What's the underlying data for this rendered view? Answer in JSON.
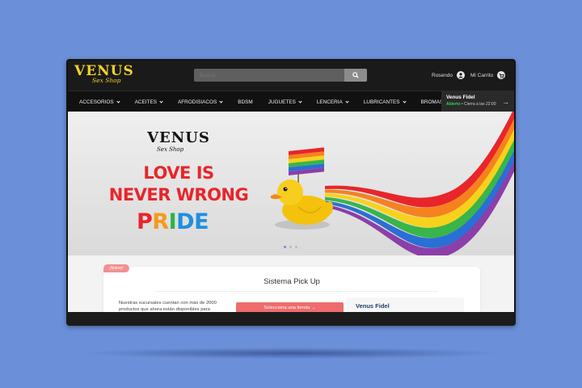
{
  "header": {
    "logo": "VENUS",
    "logo_sub": "Sex Shop",
    "search_placeholder": "Buscar",
    "user_name": "Rosendo",
    "cart_label": "Mi Carrito"
  },
  "nav": {
    "items": [
      {
        "label": "ACCESORIOS",
        "dropdown": true
      },
      {
        "label": "ACEITES",
        "dropdown": true
      },
      {
        "label": "AFRODISIACOS",
        "dropdown": true
      },
      {
        "label": "BDSM",
        "dropdown": false
      },
      {
        "label": "JUGUETES",
        "dropdown": true
      },
      {
        "label": "LENCERIA",
        "dropdown": true
      },
      {
        "label": "LUBRICANTES",
        "dropdown": true
      },
      {
        "label": "BROMAS",
        "dropdown": false
      }
    ],
    "store": {
      "name": "Venus Fidel",
      "open": "Abierto",
      "closes": "• Cierra a las 22:00"
    }
  },
  "banner": {
    "logo": "VENUS",
    "logo_sub": "Sex Shop",
    "line1": "LOVE IS",
    "line2": "NEVER WRONG",
    "pride_letters": [
      {
        "ch": "P",
        "color": "#e8252a"
      },
      {
        "ch": "R",
        "color": "#f59a1b"
      },
      {
        "ch": "I",
        "color": "#2db34a"
      },
      {
        "ch": "D",
        "color": "#1f8fe0"
      },
      {
        "ch": "E",
        "color": "#1f8fe0"
      }
    ],
    "slides": 3,
    "active_slide": 1,
    "rainbow_colors": [
      "#e8252a",
      "#f5821f",
      "#f7d21c",
      "#39b54a",
      "#2a6fd6",
      "#8b3fa8"
    ]
  },
  "pickup": {
    "tag": "¡Nuevo!",
    "title": "Sistema Pick Up",
    "text": "Nuestras sucursales cuentan con más de 2000 productos que ahora están disponibles para",
    "button_label": "Selecciona una tienda",
    "store_name": "Venus Fidel"
  },
  "colors": {
    "accent": "#f2d12a",
    "cta": "#ef6c6c",
    "background": "#6b8fd8"
  }
}
